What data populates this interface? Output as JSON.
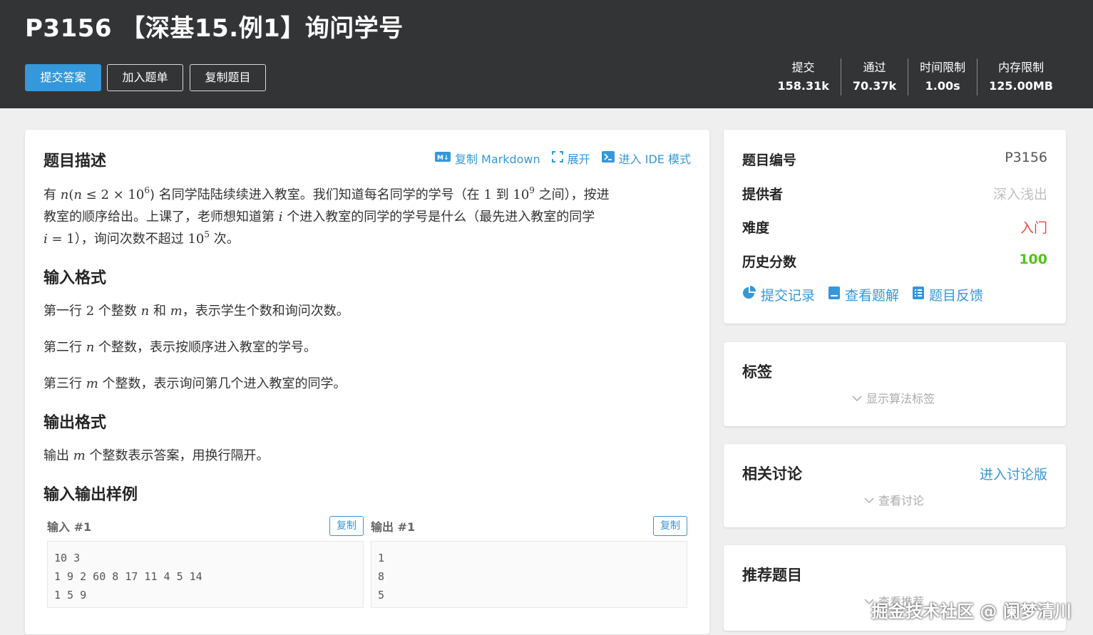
{
  "header": {
    "title": "P3156 【深基15.例1】询问学号",
    "buttons": {
      "submit": "提交答案",
      "add_list": "加入题单",
      "copy_problem": "复制题目"
    },
    "stats": [
      {
        "label": "提交",
        "value": "158.31k"
      },
      {
        "label": "通过",
        "value": "70.37k"
      },
      {
        "label": "时间限制",
        "value": "1.00s"
      },
      {
        "label": "内存限制",
        "value": "125.00MB"
      }
    ]
  },
  "main": {
    "description_title": "题目描述",
    "tools": {
      "copy_markdown": "复制 Markdown",
      "expand": "展开",
      "ide_mode": "进入 IDE 模式"
    },
    "desc": {
      "p1_a": "有 ",
      "p1_n": "n",
      "p1_b": "(",
      "p1_n2": "n",
      "p1_c": " ≤ 2 × 10",
      "p1_exp": "6",
      "p1_d": ") 名同学陆陆续续进入教室。我们知道每名同学的学号（在 ",
      "p1_e": "1",
      "p1_f": " 到 ",
      "p1_g": "10",
      "p1_exp2": "9",
      "p1_h": " 之间），按进",
      "p2_a": "教室的顺序给出。上课了，老师想知道第 ",
      "p2_i": "i",
      "p2_b": " 个进入教室的同学的学号是什么（最先进入教室的同学",
      "p3_i": "i",
      "p3_a": " = 1",
      "p3_b": "），询问次数不超过 ",
      "p3_c": "10",
      "p3_exp": "5",
      "p3_d": " 次。"
    },
    "input_title": "输入格式",
    "input": {
      "l1_a": "第一行 ",
      "l1_2": "2",
      "l1_b": " 个整数 ",
      "l1_n": "n",
      "l1_c": " 和 ",
      "l1_m": "m",
      "l1_d": "，表示学生个数和询问次数。",
      "l2_a": "第二行 ",
      "l2_n": "n",
      "l2_b": " 个整数，表示按顺序进入教室的学号。",
      "l3_a": "第三行 ",
      "l3_m": "m",
      "l3_b": " 个整数，表示询问第几个进入教室的同学。"
    },
    "output_title": "输出格式",
    "output": {
      "a": "输出 ",
      "m": "m",
      "b": " 个整数表示答案，用换行隔开。"
    },
    "samples_title": "输入输出样例",
    "sample_input_label": "输入 #1",
    "sample_output_label": "输出 #1",
    "copy_label": "复制",
    "sample_input_lines": [
      "10 3",
      "1 9 2 60 8 17 11 4 5 14",
      "1 5 9"
    ],
    "sample_output_lines": [
      "1",
      "8",
      "5"
    ]
  },
  "sidebar": {
    "info": {
      "id_label": "题目编号",
      "id_value": "P3156",
      "provider_label": "提供者",
      "provider_value": "深入浅出",
      "difficulty_label": "难度",
      "difficulty_value": "入门",
      "score_label": "历史分数",
      "score_value": "100",
      "links": {
        "records": "提交记录",
        "solutions": "查看题解",
        "feedback": "题目反馈"
      }
    },
    "tags": {
      "title": "标签",
      "toggle": "显示算法标签"
    },
    "discuss": {
      "title": "相关讨论",
      "enter": "进入讨论版",
      "toggle": "查看讨论"
    },
    "recommend": {
      "title": "推荐题目",
      "toggle": "查看推荐"
    }
  },
  "watermark": "掘金技术社区 @ 阑梦清川",
  "colors": {
    "header_bg": "#333436",
    "accent": "#3498db",
    "difficulty": "#e74c3c",
    "score": "#52c41a",
    "provider": "#bfbfbf"
  }
}
